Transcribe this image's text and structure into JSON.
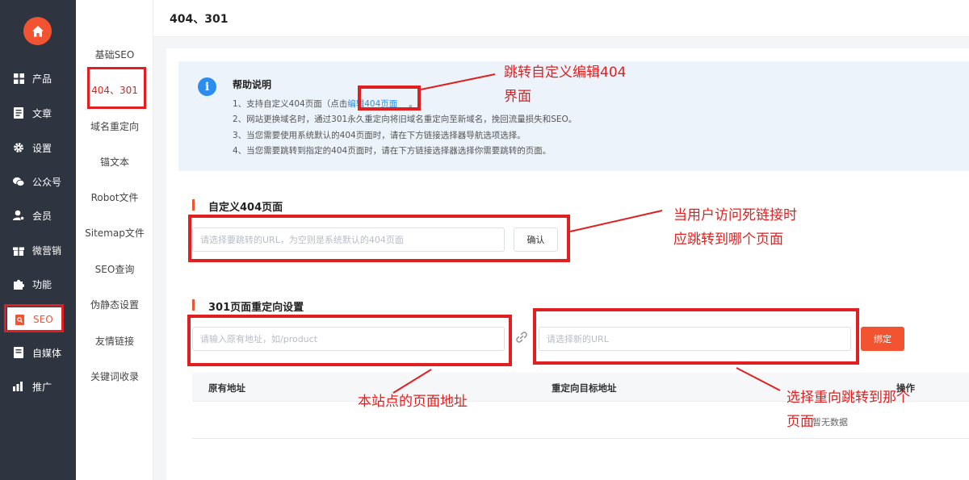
{
  "sidebar": {
    "items": [
      {
        "label": "产品",
        "icon": "grid-icon"
      },
      {
        "label": "文章",
        "icon": "document-icon"
      },
      {
        "label": "设置",
        "icon": "gear-icon"
      },
      {
        "label": "公众号",
        "icon": "wechat-icon"
      },
      {
        "label": "会员",
        "icon": "member-icon"
      },
      {
        "label": "微营销",
        "icon": "gift-icon"
      },
      {
        "label": "功能",
        "icon": "puzzle-icon"
      },
      {
        "label": "SEO",
        "icon": "seo-icon",
        "active": true
      },
      {
        "label": "自媒体",
        "icon": "media-icon"
      },
      {
        "label": "推广",
        "icon": "chart-icon"
      }
    ]
  },
  "submenu": {
    "items": [
      {
        "label": "基础SEO"
      },
      {
        "label": "404、301",
        "active": true
      },
      {
        "label": "域名重定向"
      },
      {
        "label": "锚文本"
      },
      {
        "label": "Robot文件"
      },
      {
        "label": "Sitemap文件"
      },
      {
        "label": "SEO查询"
      },
      {
        "label": "伪静态设置"
      },
      {
        "label": "友情链接"
      },
      {
        "label": "关键词收录"
      }
    ]
  },
  "header": {
    "title": "404、301"
  },
  "help": {
    "title": "帮助说明",
    "line1_prefix": "1、支持自定义404页面（点击",
    "line1_link": "编辑404页面",
    "line1_suffix": "。",
    "line2": "2、网站更换域名时，通过301永久重定向将旧域名重定向至新域名，挽回流量损失和SEO。",
    "line3": "3、当您需要使用系统默认的404页面时，请在下方链接选择器导航选项选择。",
    "line4": "4、当您需要跳转到指定的404页面时，请在下方链接选择器选择你需要跳转的页面。"
  },
  "custom404": {
    "title": "自定义404页面",
    "placeholder": "请选择要跳转的URL，为空则是系统默认的404页面",
    "confirm_label": "确认"
  },
  "redirect301": {
    "title": "301页面重定向设置",
    "source_placeholder": "请输入原有地址，如/product",
    "target_placeholder": "请选择新的URL",
    "bind_label": "绑定"
  },
  "table": {
    "columns": [
      "原有地址",
      "重定向目标地址",
      "操作"
    ],
    "empty_text": "暂无数据"
  },
  "annotations": {
    "a1_line1": "跳转自定义编辑404",
    "a1_line2": "界面",
    "a2_line1": "当用户访问死链接时",
    "a2_line2": "应跳转到哪个页面",
    "a3": "本站点的页面地址",
    "a4_line1": "选择重向跳转到那个",
    "a4_line2": "页面"
  },
  "colors": {
    "accent": "#f25432",
    "annotation": "#e02020",
    "info": "#2d8cf0",
    "rail": "#2f3441"
  }
}
